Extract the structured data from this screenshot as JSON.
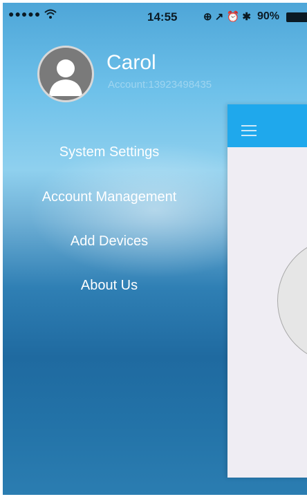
{
  "status_bar": {
    "signal": "●●●●●",
    "time": "14:55",
    "icons": "⊕ ↗ ⏰ ✱",
    "battery": "90%"
  },
  "profile": {
    "name": "Carol",
    "account": "Account:13923498435"
  },
  "menu": {
    "items": [
      {
        "label": "System Settings"
      },
      {
        "label": "Account Management"
      },
      {
        "label": "Add Devices"
      },
      {
        "label": "About Us"
      }
    ]
  },
  "colors": {
    "accent": "#1fa8ec",
    "card_bg": "#efedf3"
  }
}
